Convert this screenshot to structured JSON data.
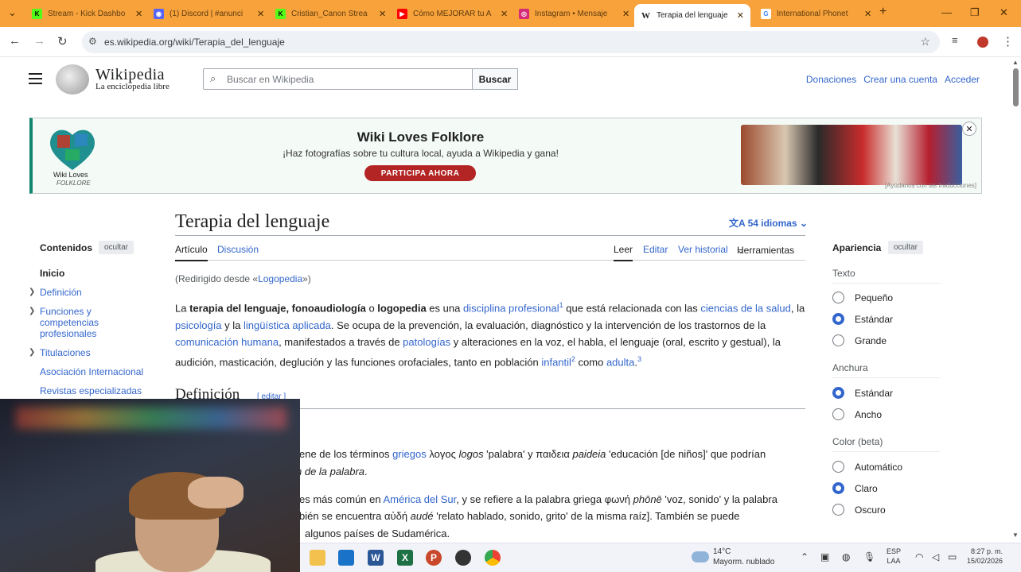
{
  "browser": {
    "tabs": [
      {
        "title": "Stream - Kick Dashbo",
        "icon": "kick-icon",
        "color": "#53fc18",
        "active": false
      },
      {
        "title": "(1) Discord | #anunci",
        "icon": "discord-icon",
        "color": "#5865f2",
        "active": false
      },
      {
        "title": "Cristian_Canon Strea",
        "icon": "kick-icon",
        "color": "#53fc18",
        "active": false
      },
      {
        "title": "Cómo MEJORAR tu A",
        "icon": "youtube-icon",
        "color": "#ff0000",
        "active": false
      },
      {
        "title": "Instagram • Mensaje",
        "icon": "instagram-icon",
        "color": "#d62976",
        "active": false
      },
      {
        "title": "Terapia del lenguaje",
        "icon": "wikipedia-icon",
        "color": "#ffffff",
        "active": true
      },
      {
        "title": "International Phonet",
        "icon": "google-icon",
        "color": "#4285f4",
        "active": false
      }
    ],
    "new_tab": "+",
    "url": "es.wikipedia.org/wiki/Terapia_del_lenguaje"
  },
  "wiki": {
    "wordmark": "Wikipedia",
    "tagline": "La enciclopedia libre",
    "search_placeholder": "Buscar en Wikipedia",
    "search_button": "Buscar",
    "user_links": [
      "Donaciones",
      "Crear una cuenta",
      "Acceder"
    ]
  },
  "banner": {
    "logo_line1": "Wiki Loves",
    "logo_line2": "FOLKLORE",
    "title": "Wiki Loves Folklore",
    "subtitle": "¡Haz fotografías sobre tu cultura local, ayuda a Wikipedia y gana!",
    "cta": "PARTICIPA AHORA",
    "credit": "[Ayúdanos con las traducciones]"
  },
  "toc": {
    "heading": "Contenidos",
    "hide": "ocultar",
    "items": [
      "Inicio",
      "Definición",
      "Funciones y competencias profesionales",
      "Titulaciones",
      "Asociación Internacional",
      "Revistas especializadas"
    ]
  },
  "article": {
    "title": "Terapia del lenguaje",
    "languages": "54 idiomas",
    "tab_article": "Artículo",
    "tab_discussion": "Discusión",
    "action_read": "Leer",
    "action_edit": "Editar",
    "action_history": "Ver historial",
    "action_tools": "Herramientas",
    "redirect_prefix": "(Redirigido desde «",
    "redirect_link": "Logopedia",
    "redirect_suffix": "»)",
    "para": {
      "t1": "La ",
      "b1": "terapia del lenguaje, fonoaudiología",
      "t2": " o ",
      "b2": "logopedia",
      "t3": " es una ",
      "l1": "disciplina profesional",
      "s1": "1",
      "t4": "  que está relacionada con las ",
      "l2": "ciencias de la salud",
      "t5": ", la ",
      "l3": "psicología",
      "t6": " y la ",
      "l4": "lingüística aplicada",
      "t7": ". Se ocupa de la prevención, la evaluación, diagnóstico y la intervención de los trastornos de la ",
      "l5": "comunicación humana",
      "t8": ", manifestados a través de ",
      "l6": "patologías",
      "t9": " y alteraciones en la voz, el habla, el lenguaje (oral, escrito y gestual), la audición, masticación, deglución y las funciones orofaciales, tanto en población ",
      "l7": "infantil",
      "s2": "2",
      "t10": "  como ",
      "l8": "adulta",
      "s3": "3"
    },
    "section_title": "Definición",
    "section_edit": "[ editar ]",
    "lines": {
      "l1a": "ene de los términos ",
      "l1b": "griegos",
      "l1c": " λογος ",
      "l1d": "logos",
      "l1e": " 'palabra' y παιδεια ",
      "l1f": "paideia",
      "l1g": " 'educación [de niños]' que podrían",
      "l2": "n de la palabra",
      "l2end": ".",
      "l3a": "es más común en ",
      "l3b": "América del Sur",
      "l3c": ", y se refiere a la palabra griega φωνή ",
      "l3d": "phōnē",
      "l3e": " 'voz, sonido' y la palabra",
      "l4a": "bién se encuentra αὐδή ",
      "l4b": "audé",
      "l4c": " 'relato hablado, sonido, grito' de la misma raíz]. También se puede",
      "l5": "algunos países de Sudamérica."
    }
  },
  "appearance": {
    "heading": "Apariencia",
    "hide": "ocultar",
    "text_label": "Texto",
    "text_options": [
      "Pequeño",
      "Estándar",
      "Grande"
    ],
    "width_label": "Anchura",
    "width_options": [
      "Estándar",
      "Ancho"
    ],
    "color_label": "Color (beta)",
    "color_options": [
      "Automático",
      "Claro",
      "Oscuro"
    ]
  },
  "taskbar": {
    "temp": "14°C",
    "weather": "Mayorm. nublado",
    "lang1": "ESP",
    "lang2": "LAA",
    "time": "8:27 p. m.",
    "date": "15/02/2026"
  }
}
